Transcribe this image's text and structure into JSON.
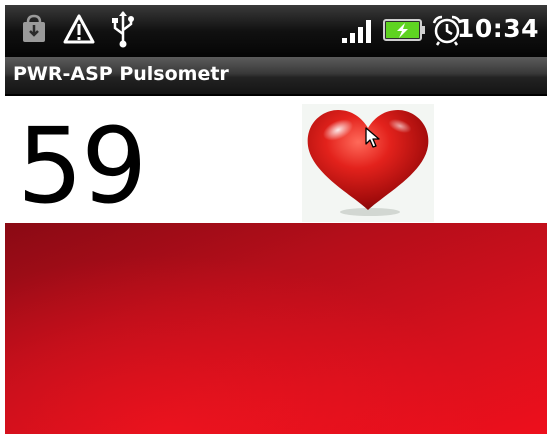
{
  "status_bar": {
    "time": "10:34",
    "icons": [
      "store-download-icon",
      "warning-triangle-icon",
      "usb-icon",
      "signal-icon",
      "battery-charging-icon",
      "alarm-clock-icon"
    ]
  },
  "app": {
    "title": "PWR-ASP Pulsometr"
  },
  "reading": {
    "bpm": "59"
  },
  "colors": {
    "accent_red": "#d7101d",
    "status_bar_bg": "#111111",
    "battery_green": "#5fd321"
  }
}
